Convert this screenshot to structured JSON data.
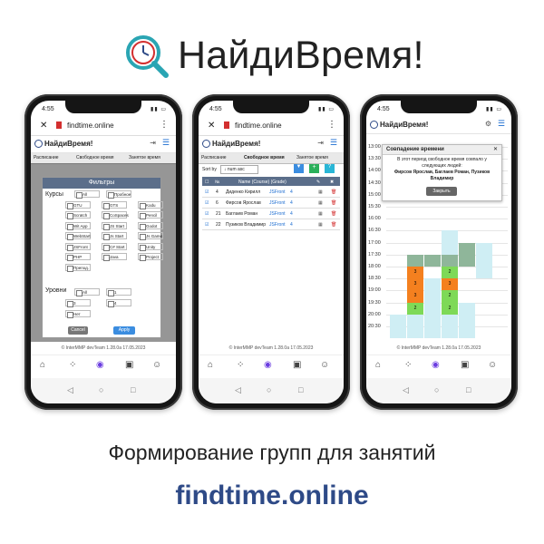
{
  "brand": {
    "title": "НайдиВремя!",
    "accent": "#2e4a87",
    "danger": "#d32f2f"
  },
  "tagline": "Формирование групп для занятий",
  "site": "findtime.online",
  "common": {
    "time": "4:55",
    "url": "findtime.online",
    "app_title": "НайдиВремя!",
    "footer": "© InterMMP  devTeam  1.28.0a  17.05.2023",
    "tabs": [
      "Расписание",
      "Свободное время",
      "Занятое время"
    ]
  },
  "phone1": {
    "modal_title": "Фильтры",
    "courses_label": "Курсы",
    "courses": [
      "All",
      "Пробное",
      "GTU",
      "GTS",
      "Kodu",
      "Scratch",
      "CoSpaces",
      "Pencil",
      "Wit App",
      "JS Start",
      "Godot",
      "WebStart",
      "Js Start",
      "Js Game",
      "JSFront",
      "C# Start",
      "Unity",
      "PHP",
      "Java",
      "Project",
      "Препод."
    ],
    "levels_label": "Уровни",
    "levels": [
      "All",
      "1",
      "3",
      "4",
      "Нет"
    ],
    "cancel": "Cancel",
    "apply": "Apply"
  },
  "phone2": {
    "sort_label": "Sort by",
    "sort_value": "↓ num asc",
    "headers": [
      "№",
      "Name (Course) (Grade)"
    ],
    "rows": [
      {
        "n": "4",
        "name": "Диденко Кирилл",
        "course": "JSFront",
        "grade": "4"
      },
      {
        "n": "6",
        "name": "Фирсов Ярослав",
        "course": "JSFront",
        "grade": "4"
      },
      {
        "n": "21",
        "name": "Баглаев Роман",
        "course": "JSFront",
        "grade": "4"
      },
      {
        "n": "22",
        "name": "Пузиков Владимир",
        "course": "JSFront",
        "grade": "4"
      }
    ]
  },
  "phone3": {
    "dialog_title": "Совпадение времени",
    "dialog_text": "В этот период свободное время совпало у следующих людей:",
    "dialog_names": "Фирсов Ярослав, Баглаев Роман, Пузиков Владимир",
    "close": "Закрыть",
    "times": [
      "13:00",
      "13:30",
      "14:00",
      "14:30",
      "15:00",
      "15:30",
      "16:00",
      "16:30",
      "17:00",
      "17:30",
      "18:00",
      "18:30",
      "19:00",
      "19:30",
      "20:00",
      "20:30"
    ],
    "orange_cells": [
      "3",
      "3",
      "3",
      "3",
      "3",
      "3"
    ],
    "green_cells": [
      "2",
      "2",
      "2",
      "2"
    ]
  }
}
